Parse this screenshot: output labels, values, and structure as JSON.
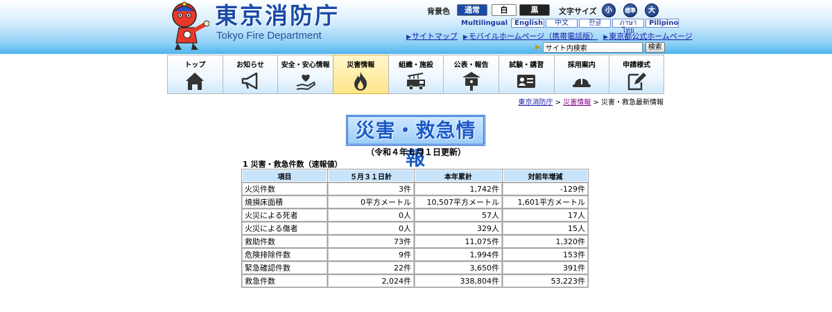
{
  "header": {
    "site_title": "東京消防庁",
    "site_title_en": "Tokyo Fire Department",
    "bg_color_label": "背景色",
    "bg_normal": "通常",
    "bg_white": "白",
    "bg_black": "黒",
    "font_size_label": "文字サイズ",
    "font_small": "小",
    "font_standard": "標準",
    "font_large": "大",
    "multilingual": "Multilingual",
    "languages": [
      "English",
      "中文",
      "한글",
      "ภาษาไทย",
      "Pilipino"
    ],
    "links": [
      "サイトマップ",
      "モバイルホームページ（携帯電話版）",
      "東京都公式ホームページ"
    ],
    "search_placeholder": "サイト内検索",
    "search_button": "検索",
    "header_color": "#4fb4ee"
  },
  "nav": [
    {
      "label": "トップ",
      "icon": "house-icon"
    },
    {
      "label": "お知らせ",
      "icon": "megaphone-icon"
    },
    {
      "label": "安全・安心情報",
      "icon": "heart-hand-icon"
    },
    {
      "label": "災害情報",
      "icon": "flame-icon",
      "active": true
    },
    {
      "label": "組織・施設",
      "icon": "fire-truck-icon"
    },
    {
      "label": "公表・報告",
      "icon": "notice-board-icon"
    },
    {
      "label": "試験・講習",
      "icon": "id-card-icon"
    },
    {
      "label": "採用案内",
      "icon": "helmet-icon"
    },
    {
      "label": "申請様式",
      "icon": "edit-form-icon"
    }
  ],
  "breadcrumb": {
    "home": "東京消防庁",
    "sep": " > ",
    "section": "災害情報",
    "current": "災害・救急最新情報"
  },
  "page": {
    "title": "災害・救急情報",
    "update_note": "（令和４年６月１日更新）",
    "section_heading": "1 災害・救急件数（速報値）"
  },
  "table": {
    "headers": [
      "項目",
      "５月３１日計",
      "本年累計",
      "対前年増減"
    ],
    "rows": [
      [
        "火災件数",
        "3件",
        "1,742件",
        "-129件"
      ],
      [
        "焼損床面積",
        "0平方メートル",
        "10,507平方メートル",
        "1,601平方メートル"
      ],
      [
        "火災による死者",
        "0人",
        "57人",
        "17人"
      ],
      [
        "火災による傷者",
        "0人",
        "329人",
        "15人"
      ],
      [
        "救助件数",
        "73件",
        "11,075件",
        "1,320件"
      ],
      [
        "危険排除件数",
        "9件",
        "1,994件",
        "153件"
      ],
      [
        "緊急確認件数",
        "22件",
        "3,650件",
        "391件"
      ],
      [
        "救急件数",
        "2,024件",
        "338,804件",
        "53,223件"
      ]
    ]
  }
}
